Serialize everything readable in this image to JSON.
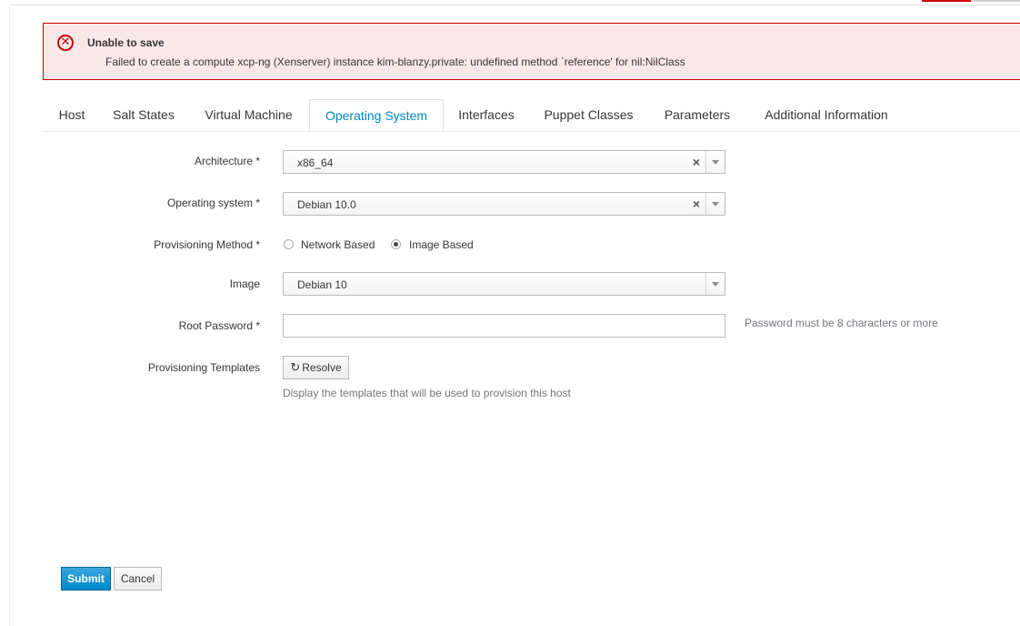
{
  "alert": {
    "title": "Unable to save",
    "message": "Failed to create a compute xcp-ng (Xenserver) instance kim-blanzy.private: undefined method `reference' for nil:NilClass",
    "icon": "error-circle-icon"
  },
  "tabs": [
    {
      "label": "Host"
    },
    {
      "label": "Salt States"
    },
    {
      "label": "Virtual Machine"
    },
    {
      "label": "Operating System",
      "active": true
    },
    {
      "label": "Interfaces"
    },
    {
      "label": "Puppet Classes"
    },
    {
      "label": "Parameters"
    },
    {
      "label": "Additional Information"
    }
  ],
  "form": {
    "architecture": {
      "label": "Architecture *",
      "value": "x86_64",
      "clear": "×"
    },
    "operating_system": {
      "label": "Operating system *",
      "value": "Debian 10.0",
      "clear": "×"
    },
    "provisioning_method": {
      "label": "Provisioning Method *",
      "options": [
        {
          "label": "Network Based",
          "checked": false
        },
        {
          "label": "Image Based",
          "checked": true
        }
      ]
    },
    "image": {
      "label": "Image",
      "value": "Debian 10"
    },
    "root_password": {
      "label": "Root Password *",
      "value": "",
      "help": "Password must be 8 characters or more"
    },
    "provisioning_templates": {
      "label": "Provisioning Templates",
      "button": "Resolve",
      "help": "Display the templates that will be used to provision this host"
    }
  },
  "actions": {
    "submit": "Submit",
    "cancel": "Cancel"
  },
  "colors": {
    "accent": "#0088ce",
    "error": "#cc0000",
    "error_bg": "#fbe7e8"
  }
}
